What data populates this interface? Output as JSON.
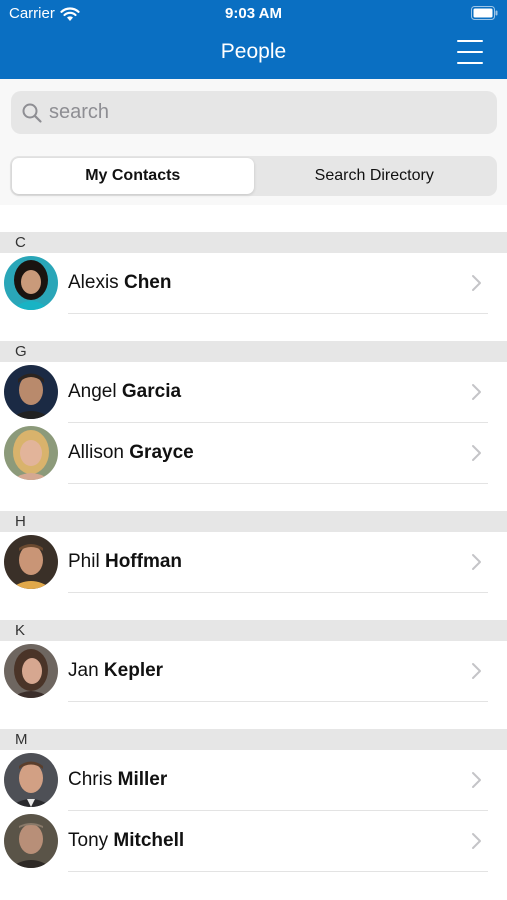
{
  "status_bar": {
    "carrier": "Carrier",
    "time": "9:03 AM"
  },
  "header": {
    "title": "People"
  },
  "search": {
    "placeholder": "search",
    "value": ""
  },
  "segments": [
    {
      "label": "My Contacts",
      "active": true
    },
    {
      "label": "Search Directory",
      "active": false
    }
  ],
  "colors": {
    "header_bg": "#0a6fc2",
    "section_bg": "#e6e6e6"
  },
  "sections": [
    {
      "letter": "C",
      "contacts": [
        {
          "first": "Alexis",
          "last": "Chen"
        }
      ]
    },
    {
      "letter": "G",
      "contacts": [
        {
          "first": "Angel",
          "last": "Garcia"
        },
        {
          "first": "Allison",
          "last": "Grayce"
        }
      ]
    },
    {
      "letter": "H",
      "contacts": [
        {
          "first": "Phil",
          "last": "Hoffman"
        }
      ]
    },
    {
      "letter": "K",
      "contacts": [
        {
          "first": "Jan",
          "last": "Kepler"
        }
      ]
    },
    {
      "letter": "M",
      "contacts": [
        {
          "first": "Chris",
          "last": "Miller"
        },
        {
          "first": "Tony",
          "last": "Mitchell"
        }
      ]
    }
  ]
}
